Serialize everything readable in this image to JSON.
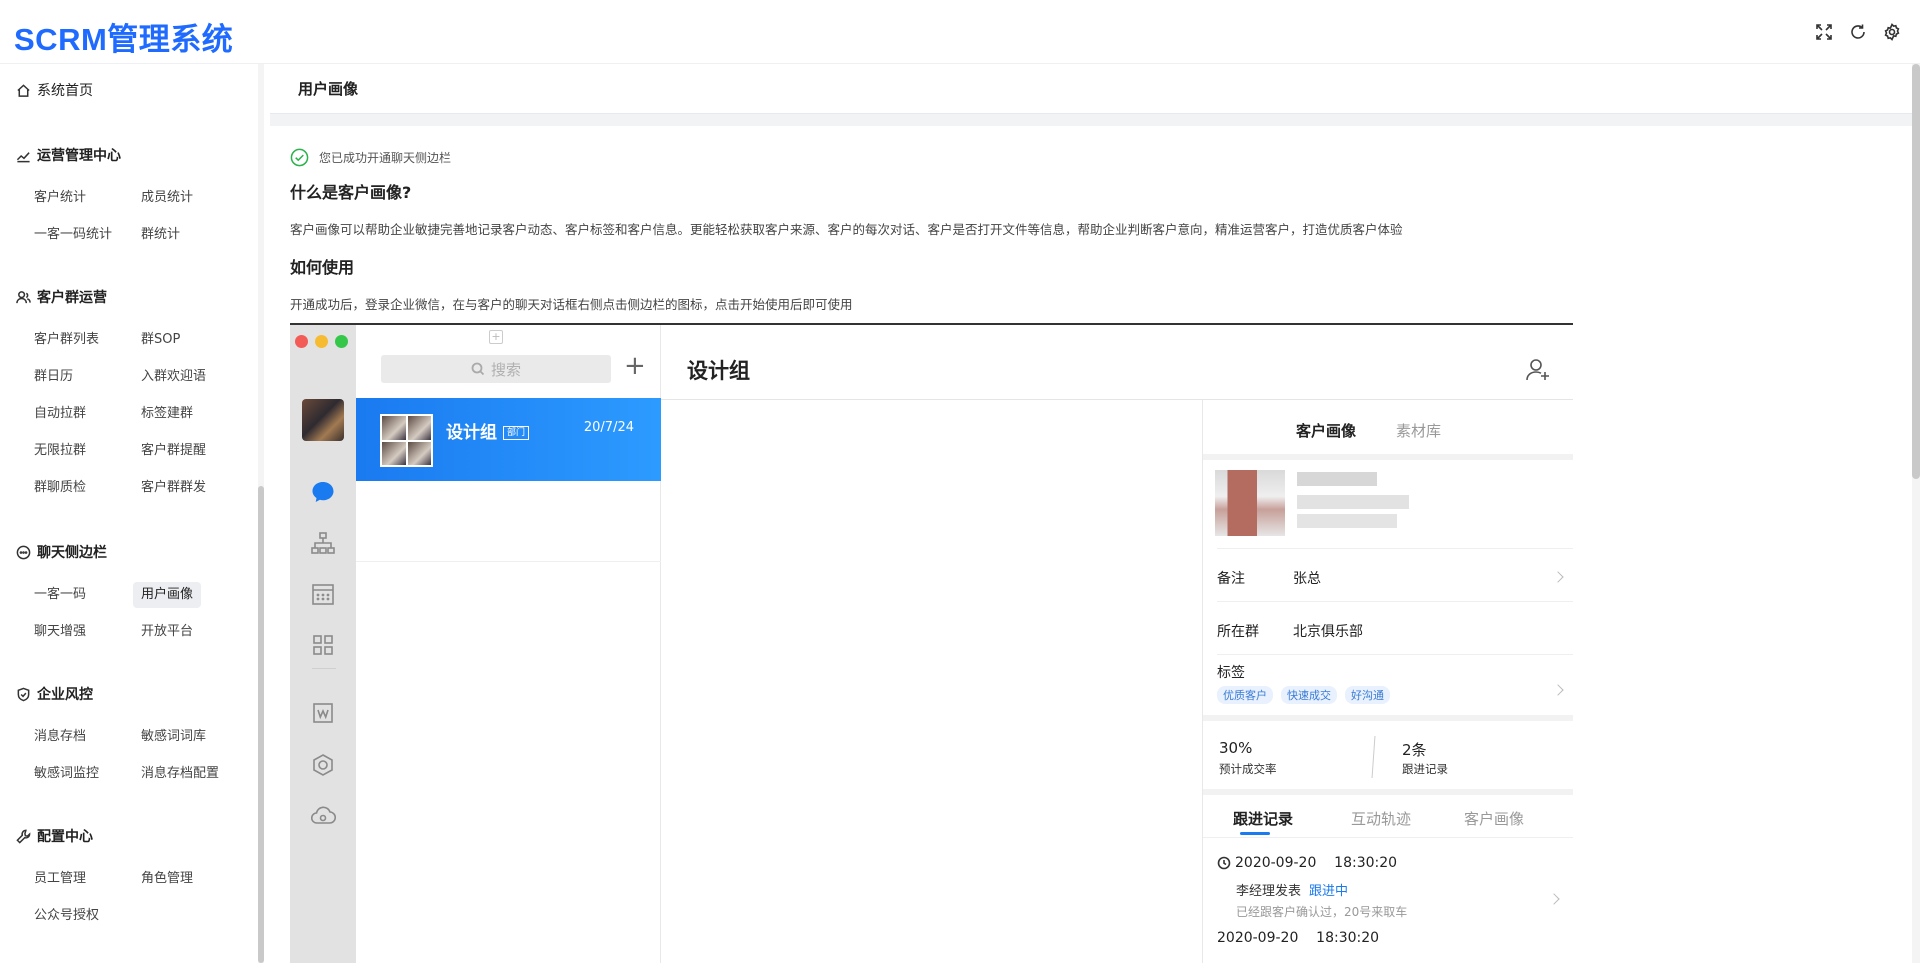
{
  "app": {
    "title": "SCRM管理系统"
  },
  "header_icons": [
    "fullscreen-icon",
    "refresh-icon",
    "settings-icon"
  ],
  "sidebar": {
    "home": "系统首页",
    "groups": [
      {
        "title": "运营管理中心",
        "icon": "chart-line-icon",
        "items": [
          "客户统计",
          "成员统计",
          "一客一码统计",
          "群统计"
        ]
      },
      {
        "title": "客户群运营",
        "icon": "group-icon",
        "items": [
          "客户群列表",
          "群SOP",
          "群日历",
          "入群欢迎语",
          "自动拉群",
          "标签建群",
          "无限拉群",
          "客户群提醒",
          "群聊质检",
          "客户群群发"
        ]
      },
      {
        "title": "聊天侧边栏",
        "icon": "chat-bubble-icon",
        "items": [
          "一客一码",
          "用户画像",
          "聊天增强",
          "开放平台"
        ],
        "active": "用户画像"
      },
      {
        "title": "企业风控",
        "icon": "shield-icon",
        "items": [
          "消息存档",
          "敏感词词库",
          "敏感词监控",
          "消息存档配置"
        ]
      },
      {
        "title": "配置中心",
        "icon": "wrench-icon",
        "items": [
          "员工管理",
          "角色管理",
          "公众号授权"
        ]
      }
    ]
  },
  "page": {
    "title": "用户画像",
    "success_msg": "您已成功开通聊天侧边栏",
    "h_what": "什么是客户画像?",
    "p_what": "客户画像可以帮助企业敏捷完善地记录客户动态、客户标签和客户信息。更能轻松获取客户来源、客户的每次对话、客户是否打开文件等信息，帮助企业判断客户意向，精准运营客户，打造优质客户体验",
    "h_how": "如何使用",
    "p_how": "开通成功后，登录企业微信，在与客户的聊天对话框右侧点击侧边栏的图标，点击开始使用后即可使用"
  },
  "mock": {
    "search_placeholder": "搜索",
    "chat": {
      "name": "设计组",
      "badge": "部门",
      "date": "20/7/24"
    },
    "chat_title": "设计组",
    "panel": {
      "tabs": [
        "客户画像",
        "素材库"
      ],
      "remark_label": "备注",
      "remark_value": "张总",
      "group_label": "所在群",
      "group_value": "北京俱乐部",
      "tags_label": "标签",
      "tags": [
        "优质客户",
        "快速成交",
        "好沟通"
      ],
      "stat1_value": "30%",
      "stat1_label": "预计成交率",
      "stat2_value": "2条",
      "stat2_label": "跟进记录",
      "follow_tabs": [
        "跟进记录",
        "互动轨迹",
        "客户画像"
      ],
      "record": {
        "time": "2020-09-20    18:30:20",
        "who": "李经理发表",
        "status": "跟进中",
        "note": "已经跟客户确认过，20号来取车"
      },
      "record2_time": "2020-09-20    18:30:20"
    }
  },
  "colors": {
    "brand": "#1f6bff",
    "accent": "#1a7af0",
    "tag_bg": "#e8f1fd"
  }
}
